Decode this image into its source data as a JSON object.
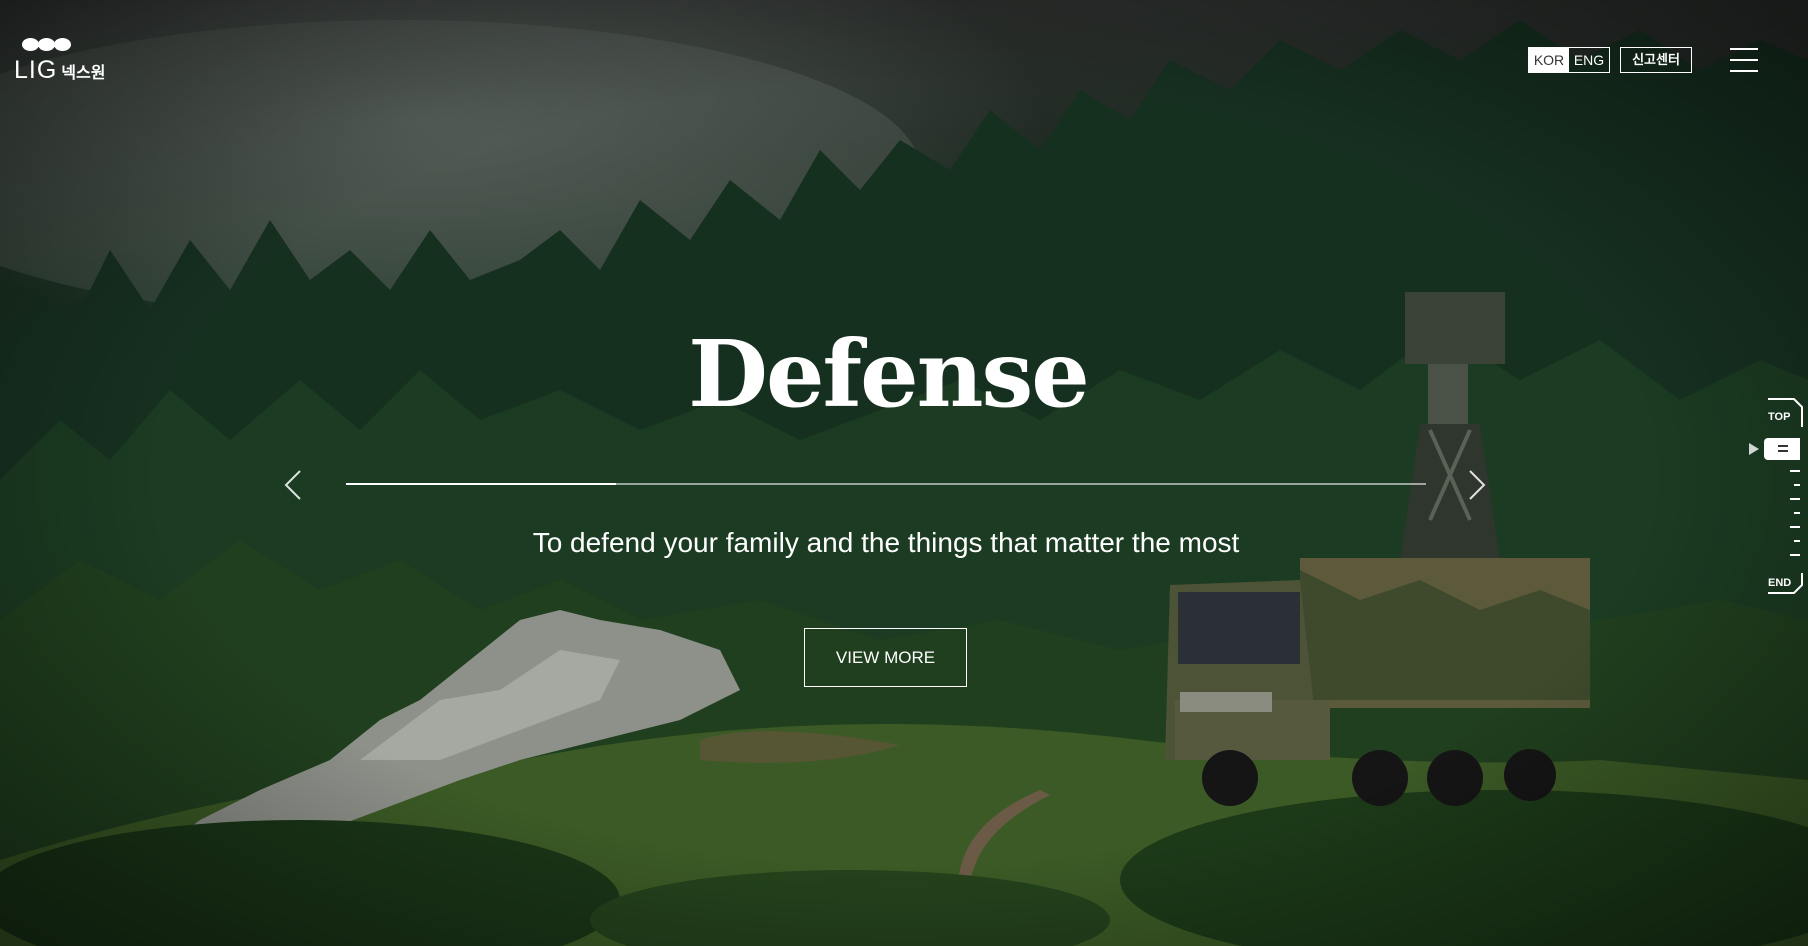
{
  "header": {
    "logo_text": "LIG",
    "logo_korean": "넥스원",
    "lang_kor": "KOR",
    "lang_eng": "ENG",
    "report_center": "신고센터",
    "menu_icon": "hamburger-icon"
  },
  "hero": {
    "title": "Defense",
    "subtitle": "To defend your family and the things that matter the most",
    "cta": "VIEW MORE",
    "slide_progress": 0.25,
    "prev_icon": "chevron-left-icon",
    "next_icon": "chevron-right-icon"
  },
  "scroll_indicator": {
    "top_label": "TOP",
    "end_label": "END"
  },
  "colors": {
    "primary_text": "#ffffff",
    "forest_dark": "#17301f",
    "forest_mid": "#21431f"
  }
}
